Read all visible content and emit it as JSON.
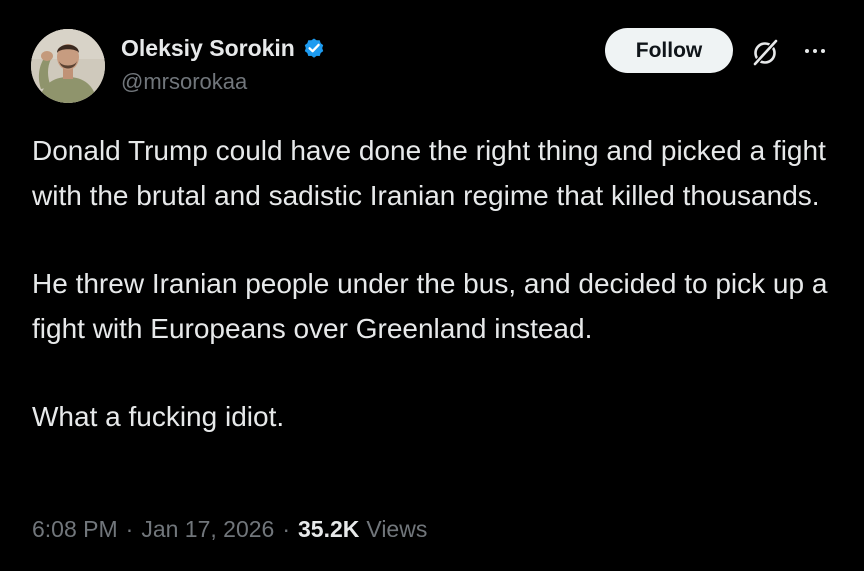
{
  "author": {
    "display_name": "Oleksiy Sorokin",
    "handle": "@mrsorokaa",
    "verified_icon": "verified-badge-icon",
    "verified_color": "#1d9bf0"
  },
  "actions": {
    "follow_label": "Follow",
    "grok_icon": "grok-icon",
    "more_icon": "more-icon"
  },
  "post": {
    "paragraphs": [
      "Donald Trump could have done the right thing and picked a fight with the brutal and sadistic Iranian regime that killed thousands.",
      "He threw Iranian people under the bus, and decided to pick up a fight with Europeans over Greenland instead.",
      "What a fucking idiot."
    ]
  },
  "meta": {
    "time": "6:08 PM",
    "separator": "·",
    "date": "Jan 17, 2026",
    "views_count": "35.2K",
    "views_label": "Views"
  },
  "colors": {
    "background": "#000000",
    "primary_text": "#e7e9ea",
    "secondary_text": "#71767b",
    "follow_bg": "#eff3f4",
    "follow_text": "#0f1419"
  }
}
